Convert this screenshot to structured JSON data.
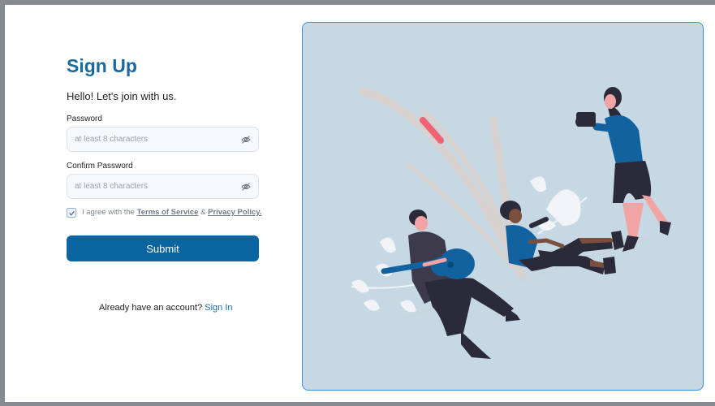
{
  "form": {
    "title": "Sign Up",
    "subtitle": "Hello! Let's join with us.",
    "password": {
      "label": "Password",
      "placeholder": "at least 8 characters"
    },
    "confirm_password": {
      "label": "Confirm Password",
      "placeholder": "at least 8 characters"
    },
    "agree": {
      "checked": true,
      "prefix": "I agree with the",
      "terms_link": "Terms of Service",
      "separator": "&",
      "privacy_link": "Privacy Policy."
    },
    "submit_label": "Submit",
    "signin_prompt": "Already have an account?",
    "signin_link": "Sign In"
  },
  "icons": {
    "password_toggle": "eye-off-icon",
    "checkbox": "check-icon"
  },
  "colors": {
    "accent": "#0a64a0",
    "title": "#1a6aa0",
    "illustration_bg": "#c5d8e3",
    "illustration_border": "#3b8ed4"
  }
}
